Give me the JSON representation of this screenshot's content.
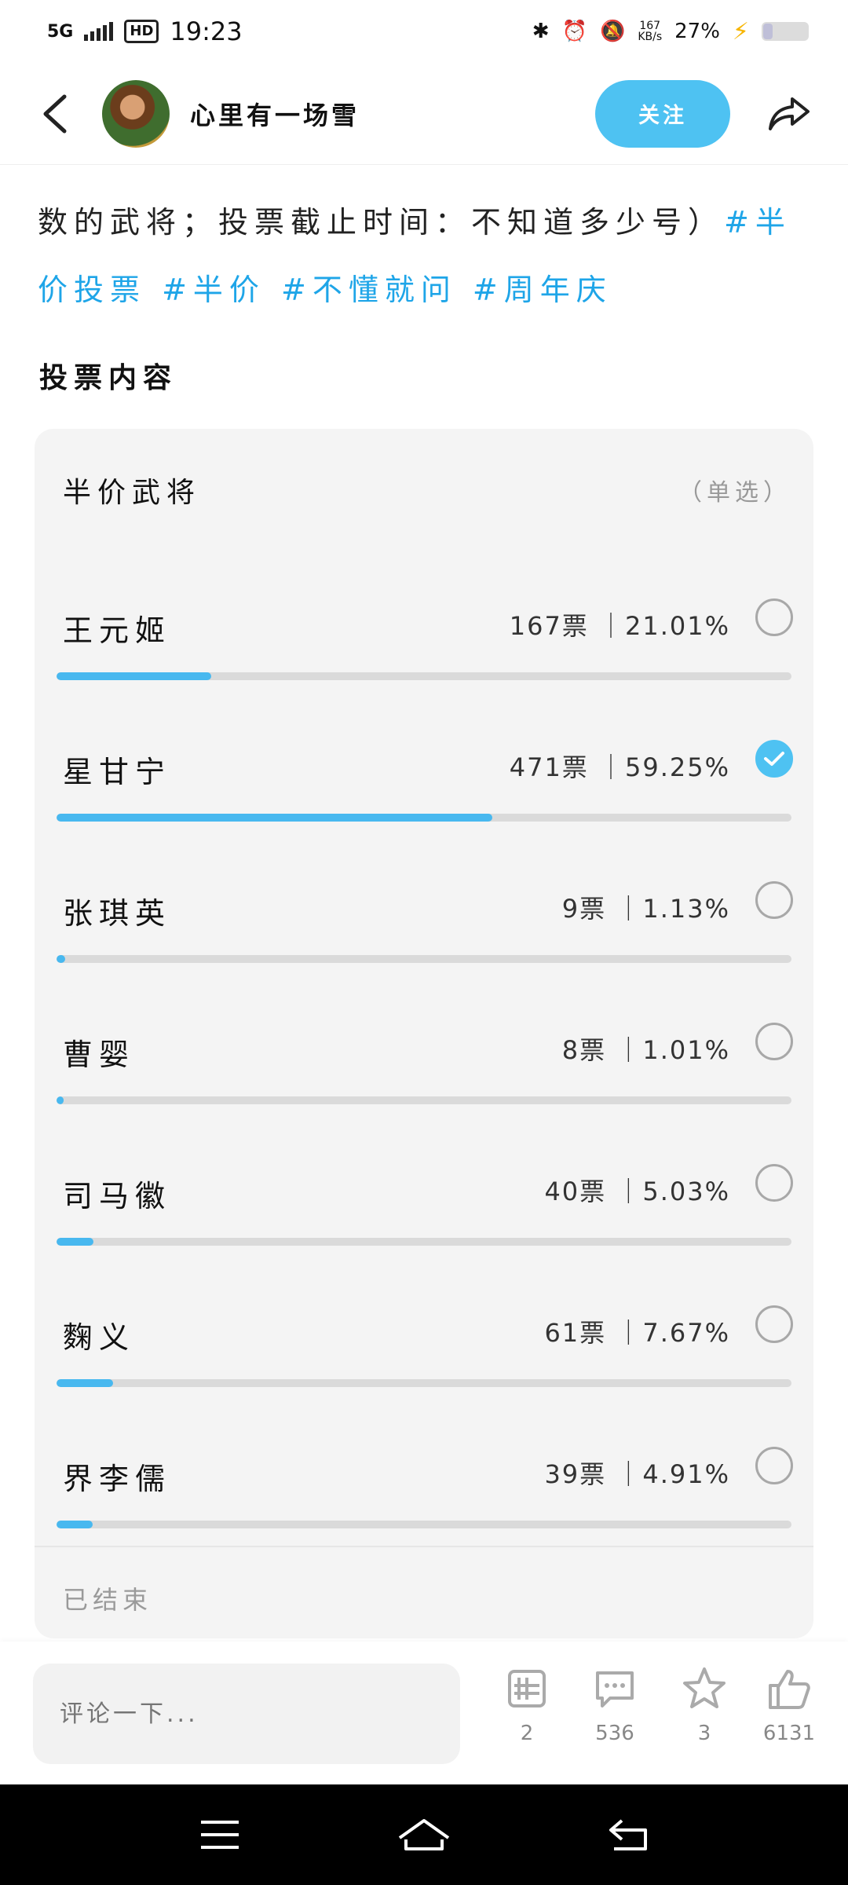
{
  "status_bar": {
    "network": "5G",
    "hd": "HD",
    "time": "19:23",
    "speed_top": "167",
    "speed_bottom": "KB/s",
    "battery": "27%"
  },
  "header": {
    "username": "心里有一场雪",
    "follow_label": "关注"
  },
  "post": {
    "text": "数的武将；投票截止时间：不知道多少号）",
    "tags": "#半价投票 #半价 #不懂就问 #周年庆"
  },
  "vote": {
    "section_title": "投票内容",
    "title": "半价武将",
    "mode": "（单选）",
    "options": [
      {
        "name": "王元姬",
        "stat": "167票 ｜21.01%",
        "percent": 21.01,
        "checked": false
      },
      {
        "name": "星甘宁",
        "stat": "471票 ｜59.25%",
        "percent": 59.25,
        "checked": true
      },
      {
        "name": "张琪英",
        "stat": "9票 ｜1.13%",
        "percent": 1.13,
        "checked": false
      },
      {
        "name": "曹婴",
        "stat": "8票 ｜1.01%",
        "percent": 1.01,
        "checked": false
      },
      {
        "name": "司马徽",
        "stat": "40票 ｜5.03%",
        "percent": 5.03,
        "checked": false
      },
      {
        "name": "麴义",
        "stat": "61票 ｜7.67%",
        "percent": 7.67,
        "checked": false
      },
      {
        "name": "界李儒",
        "stat": "39票 ｜4.91%",
        "percent": 4.91,
        "checked": false
      }
    ],
    "status": "已结束"
  },
  "actions": {
    "comment_placeholder": "评论一下...",
    "push_count": "2",
    "comment_count": "536",
    "favorite_count": "3",
    "like_count": "6131"
  },
  "colors": {
    "accent": "#4ec2f2",
    "bar_fill": "#48b8ef",
    "tag": "#1ea5e8"
  }
}
